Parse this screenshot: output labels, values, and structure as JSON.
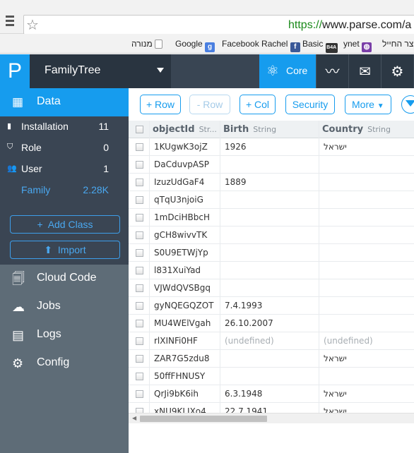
{
  "browser": {
    "url_scheme": "https://",
    "url_rest": "www.parse.com/a",
    "bookmarks": [
      {
        "label": "מנורה",
        "icon": "page-icon"
      },
      {
        "label": "Google",
        "icon": "google-icon",
        "color": "#4a7fe0",
        "glyph": "g"
      },
      {
        "label": "Facebook Rachel",
        "icon": "facebook-icon",
        "color": "#3b5998",
        "glyph": "f"
      },
      {
        "label": "Basic",
        "icon": "b4a-icon",
        "color": "#333333",
        "glyph": "B4A"
      },
      {
        "label": "ynet",
        "icon": "ynet-icon",
        "color": "#7a3fa8",
        "glyph": "◍"
      },
      {
        "label": "צר החייל",
        "icon": "israel-flag-icon"
      }
    ]
  },
  "header": {
    "logo": "P",
    "app_name": "FamilyTree",
    "core_tab": "Core",
    "icons": [
      "core-atom-icon",
      "analytics-pulse-icon",
      "push-chat-icon",
      "settings-gear-icon"
    ]
  },
  "sidebar": {
    "data_label": "Data",
    "classes": [
      {
        "label": "Installation",
        "count": "11",
        "icon": "phone-icon"
      },
      {
        "label": "Role",
        "count": "0",
        "icon": "shield-icon"
      },
      {
        "label": "User",
        "count": "1",
        "icon": "users-icon"
      },
      {
        "label": "Family",
        "count": "2.28K",
        "icon": ""
      }
    ],
    "add_class": "Add Class",
    "import": "Import",
    "nav": [
      {
        "label": "Cloud Code",
        "icon": "cloud-code-icon"
      },
      {
        "label": "Jobs",
        "icon": "jobs-icon"
      },
      {
        "label": "Logs",
        "icon": "logs-icon"
      },
      {
        "label": "Config",
        "icon": "config-gears-icon"
      }
    ]
  },
  "toolbar": {
    "add_row": "+ Row",
    "remove_row": "- Row",
    "add_col": "+ Col",
    "security": "Security",
    "more": "More"
  },
  "grid": {
    "columns": [
      {
        "name": "objectId",
        "type": "Str..."
      },
      {
        "name": "Birth",
        "type": "String"
      },
      {
        "name": "Country",
        "type": "String"
      }
    ],
    "rows": [
      {
        "id": "1KUgwK3ojZ",
        "birth": "1926",
        "country": "ישראל"
      },
      {
        "id": "DaCduvpASP",
        "birth": "",
        "country": ""
      },
      {
        "id": "IzuzUdGaF4",
        "birth": "1889",
        "country": ""
      },
      {
        "id": "qTqU3njoiG",
        "birth": "",
        "country": ""
      },
      {
        "id": "1mDciHBbcH",
        "birth": "",
        "country": ""
      },
      {
        "id": "gCH8wivvTK",
        "birth": "",
        "country": ""
      },
      {
        "id": "S0U9ETWjYp",
        "birth": "",
        "country": ""
      },
      {
        "id": "l831XuiYad",
        "birth": "",
        "country": ""
      },
      {
        "id": "VJWdQVSBgq",
        "birth": "",
        "country": ""
      },
      {
        "id": "gyNQEGQZOT",
        "birth": "7.4.1993",
        "country": ""
      },
      {
        "id": "MU4WElVgah",
        "birth": "26.10.2007",
        "country": ""
      },
      {
        "id": "rlXINFi0HF",
        "birth": "(undefined)",
        "country": "(undefined)"
      },
      {
        "id": "ZAR7G5zdu8",
        "birth": "",
        "country": "ישראל"
      },
      {
        "id": "50ffFHNUSY",
        "birth": "",
        "country": ""
      },
      {
        "id": "QrJi9bK6ih",
        "birth": "6.3.1948",
        "country": "ישראל"
      },
      {
        "id": "xNU9KLJXo4",
        "birth": "22.7.1941",
        "country": "ישראל"
      }
    ]
  },
  "colors": {
    "accent": "#169cee",
    "sidebar_dark": "#3a4553",
    "sidebar": "#5e6c77",
    "header": "#394553"
  }
}
